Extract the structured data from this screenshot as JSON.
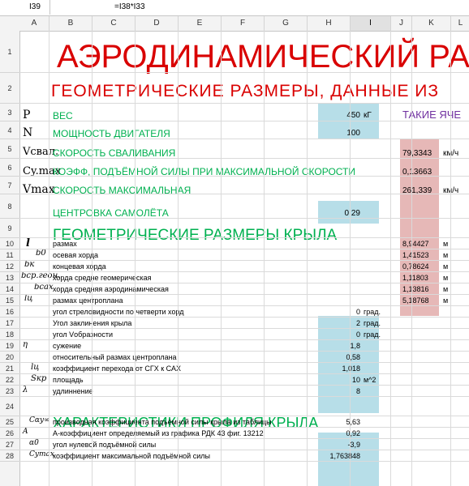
{
  "formula_bar": {
    "cell_ref": "I39",
    "formula": "=I38*I33"
  },
  "columns": [
    "A",
    "B",
    "C",
    "D",
    "E",
    "F",
    "G",
    "H",
    "I",
    "J",
    "K",
    "L"
  ],
  "rows": [
    "1",
    "2",
    "3",
    "4",
    "5",
    "6",
    "7",
    "8",
    "9",
    "10",
    "11",
    "12",
    "13",
    "14",
    "15",
    "16",
    "17",
    "18",
    "19",
    "20",
    "21",
    "22",
    "23",
    "24",
    "25",
    "26",
    "27",
    "28"
  ],
  "sheet": {
    "title": "АЭРОДИНАМИЧЕСКИЙ РА",
    "subtitle": "ГЕОМЕТРИЧЕСКИЕ РАЗМЕРЫ, ДАННЫЕ ИЗ",
    "r3": {
      "a": "P",
      "b": "ВЕС",
      "i": "450",
      "i_unit": "кГ",
      "k": "ТАКИЕ ЯЧЕ"
    },
    "r4": {
      "a": "N",
      "b": "МОЩНОСТЬ ДВИГАТЕЛЯ",
      "i": "100"
    },
    "r5": {
      "a": "Vсвал.",
      "b": "СКОРОСТЬ СВАЛИВАНИЯ",
      "k": "79,3343",
      "k_unit": "км/ч"
    },
    "r6": {
      "a": "Cy.max",
      "b": "КОЭФФ, ПОДЪЁМНОЙ СИЛЫ ПРИ МАКСИМАЛЬНОЙ СКОРОСТИ",
      "k": "0,13663"
    },
    "r7": {
      "a": "Vmax",
      "b": "СКОРОСТЬ МАКСИМАЛЬНАЯ",
      "k": "261,339",
      "k_unit": "км/ч"
    },
    "r8": {
      "b": "ЦЕНТРОВКА САМОЛЁТА",
      "i": "0,29"
    },
    "r9": {
      "b": "ГЕОМЕТРИЧЕСКИЕ РАЗМЕРЫ КРЫЛА"
    },
    "wing": [
      {
        "sym": "l",
        "text": "размах",
        "k": "8,94427",
        "unit": "м"
      },
      {
        "sym": "b0",
        "text": "осевая хорда",
        "k": "1,41523",
        "unit": "м"
      },
      {
        "sym": "bк",
        "text": "концевая хорда",
        "k": "0,78624",
        "unit": "м"
      },
      {
        "sym": "bср.геон.",
        "text": "хорда средне геомерическая",
        "k": "1,11803",
        "unit": "м"
      },
      {
        "sym": "bсах",
        "text": "хорда средняя аэродинамическая",
        "k": "1,13816",
        "unit": "м"
      },
      {
        "sym": "lц",
        "text": "размах центроплана",
        "k": "5,18768",
        "unit": "м"
      }
    ],
    "params": [
      {
        "sym": "",
        "text": "угол стреловидности по четверти хорд",
        "i": "0",
        "unit": "град."
      },
      {
        "sym": "",
        "text": "Угол заклинения крыла",
        "i": "2",
        "unit": "град."
      },
      {
        "sym": "",
        "text": "угол Vобразности",
        "i": "0",
        "unit": "град."
      },
      {
        "sym": "η",
        "text": "сужение",
        "i": "1,8",
        "unit": ""
      },
      {
        "sym": "",
        "text": "относительный размах центроплана",
        "i": "0,58",
        "unit": ""
      },
      {
        "sym": "lц",
        "text": "коэффициент перехода от СГХ к САХ",
        "i": "1,018",
        "unit": ""
      },
      {
        "sym": "Sкр",
        "text": "площадь",
        "i": "10",
        "unit": "м^2"
      },
      {
        "sym": "λ",
        "text": "удлиннение",
        "i": "8",
        "unit": ""
      }
    ],
    "r24": {
      "b": "ХАРАКТЕРИСТИКИ ПРОФИЛЯ КРЫЛА"
    },
    "profile": [
      {
        "sym": "Cαy∞",
        "text": "производная коэффициента подъёмной силы крыла из таблицы",
        "i": "5,63"
      },
      {
        "sym": "A",
        "text": "А-коэффициент определяемый из графика РДК 43 фиг. 13212",
        "i": "0,92"
      },
      {
        "sym": "α0",
        "text": "угол нулевой подъёмной силы",
        "i": "-3,9"
      },
      {
        "sym": "Cymax",
        "text": "коэффициент максимальной подъёмной силы",
        "i": "1,763848"
      }
    ]
  }
}
